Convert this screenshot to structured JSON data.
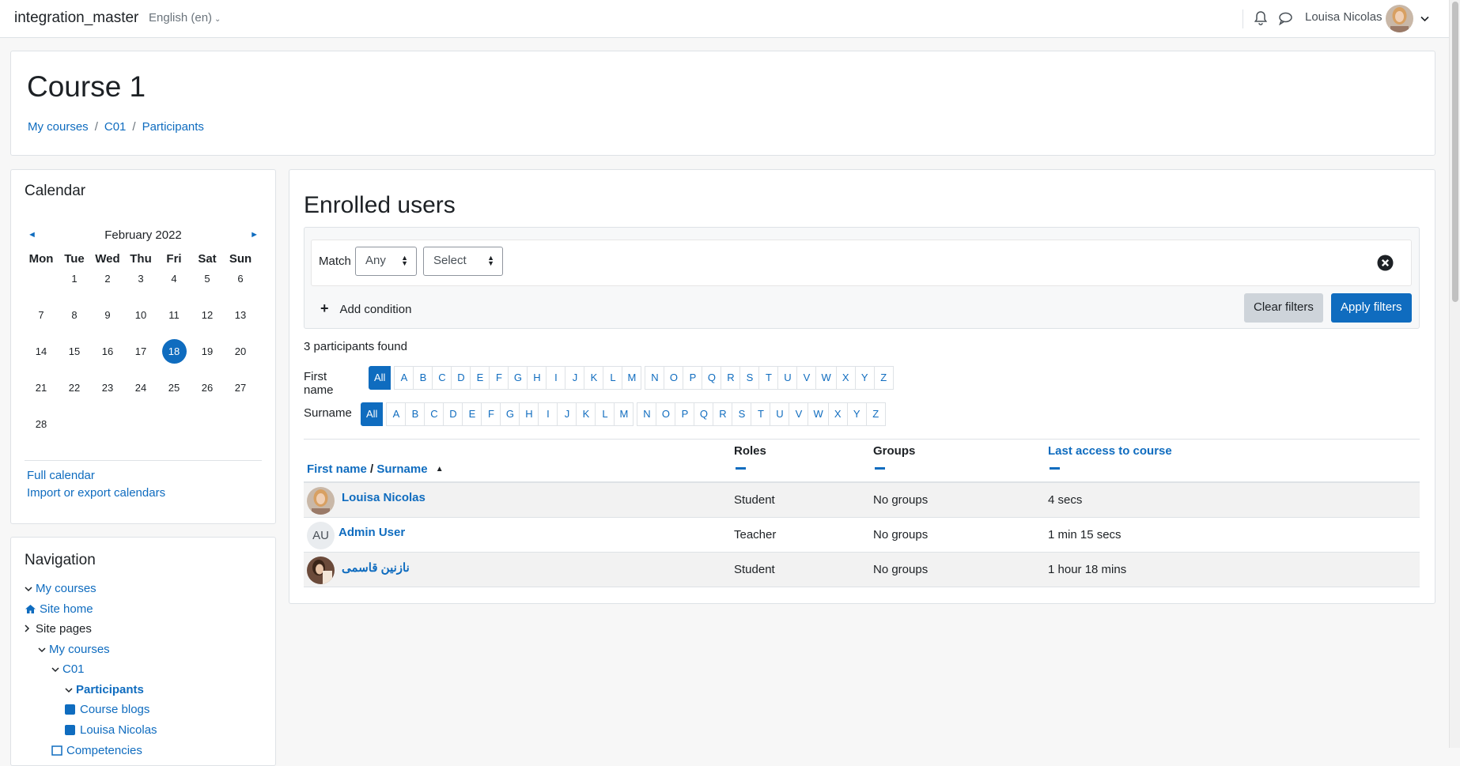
{
  "navbar": {
    "site_name": "integration_master",
    "language": "English (en)",
    "user_name": "Louisa Nicolas"
  },
  "header": {
    "course_title": "Course 1",
    "breadcrumb": [
      "My courses",
      "C01",
      "Participants"
    ]
  },
  "calendar": {
    "title": "Calendar",
    "prev": "◄",
    "next": "►",
    "month_label": "February 2022",
    "weekdays": [
      "Mon",
      "Tue",
      "Wed",
      "Thu",
      "Fri",
      "Sat",
      "Sun"
    ],
    "first_weekday_offset": 1,
    "days_in_month": 28,
    "today": 18,
    "links": [
      "Full calendar",
      "Import or export calendars"
    ]
  },
  "navigation": {
    "title": "Navigation",
    "items": [
      {
        "label": "My courses",
        "link": true,
        "twisty": "v",
        "icon": ""
      },
      {
        "label": "Site home",
        "link": true,
        "twisty": "",
        "icon": "home-icon"
      },
      {
        "label": "Site pages",
        "link": false,
        "twisty": ">",
        "icon": ""
      },
      {
        "label": "My courses",
        "link": true,
        "twisty": "v",
        "icon": ""
      },
      {
        "label": "C01",
        "link": true,
        "twisty": "v",
        "icon": ""
      },
      {
        "label": "Participants",
        "link": true,
        "bold": true,
        "twisty": "v",
        "icon": ""
      },
      {
        "label": "Course blogs",
        "link": true,
        "twisty": "",
        "icon": "square-icon"
      },
      {
        "label": "Louisa Nicolas",
        "link": true,
        "twisty": "",
        "icon": "square-icon"
      },
      {
        "label": "Competencies",
        "link": true,
        "twisty": "",
        "icon": "checklist-icon"
      }
    ]
  },
  "main": {
    "title": "Enrolled users",
    "filter": {
      "match_label": "Match",
      "match_value": "Any",
      "select_value": "Select",
      "add_condition": "Add condition",
      "clear_filters": "Clear filters",
      "apply_filters": "Apply filters"
    },
    "participants_found": "3 participants found",
    "initials": {
      "first_name_label": "First name",
      "surname_label": "Surname",
      "all_label": "All",
      "letters": [
        "A",
        "B",
        "C",
        "D",
        "E",
        "F",
        "G",
        "H",
        "I",
        "J",
        "K",
        "L",
        "M",
        "N",
        "O",
        "P",
        "Q",
        "R",
        "S",
        "T",
        "U",
        "V",
        "W",
        "X",
        "Y",
        "Z"
      ]
    },
    "table": {
      "col_first_name": "First name",
      "col_separator": "/",
      "col_surname": "Surname",
      "col_roles": "Roles",
      "col_groups": "Groups",
      "col_last_access": "Last access to course",
      "rows": [
        {
          "name": "Louisa Nicolas",
          "avatar": "photo-1",
          "initials": "",
          "role": "Student",
          "groups": "No groups",
          "last_access": "4 secs"
        },
        {
          "name": "Admin User",
          "avatar": "initials",
          "initials": "AU",
          "role": "Teacher",
          "groups": "No groups",
          "last_access": "1 min 15 secs"
        },
        {
          "name": "نازنین قاسمی",
          "avatar": "photo-2",
          "initials": "",
          "role": "Student",
          "groups": "No groups",
          "last_access": "1 hour 18 mins"
        }
      ]
    }
  },
  "colors": {
    "primary": "#0f6cbf",
    "secondary_button": "#ced4da",
    "page_background": "#f7f7f7"
  }
}
